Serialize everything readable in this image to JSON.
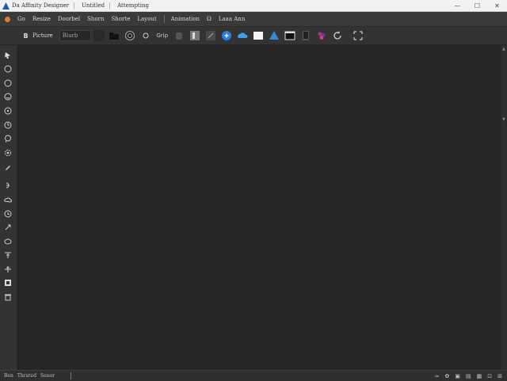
{
  "window": {
    "title_app": "Da Affinity Designer",
    "title_doc": "Untitled",
    "title_extra": "Attempting",
    "buttons": {
      "minimize": "—",
      "maximize": "☐",
      "close": "✕"
    }
  },
  "menubar": {
    "items": [
      "Go",
      "Resize",
      "Doorbel",
      "Shorn",
      "Shorte",
      "Layout",
      "Animation",
      "Ω",
      "Laaa Ann"
    ]
  },
  "toolbar": {
    "persona_label": "Picture",
    "field_value": "Blurb",
    "zoom_label": "Grip",
    "tools": [
      "folder-icon",
      "circle-icon",
      "dot-icon",
      "grip-text",
      "cup-icon",
      "square-icon",
      "dark-square-icon",
      "cube-icon",
      "cloud-icon",
      "white-square-icon",
      "triangle-icon",
      "window-icon",
      "phone-icon",
      "grapes-icon",
      "refresh-icon",
      "arrange-icon"
    ]
  },
  "left_tools": [
    "move-tool-icon",
    "ellipse-icon",
    "circle-outline-icon",
    "face-icon",
    "smile-icon",
    "node-icon",
    "lasso-icon",
    "gear-icon",
    "pen-icon",
    "blob-icon",
    "cloud-tool-icon",
    "clock-icon",
    "arrow-tool-icon",
    "oval-icon",
    "text-tool-icon",
    "cross-icon",
    "image-tool-icon",
    "trash-icon"
  ],
  "statusbar": {
    "left_items": [
      "Ben",
      "Thrated",
      "Senor"
    ],
    "right_icons": [
      "≈",
      "✿",
      "▣",
      "▤",
      "▦",
      "⊡",
      "⊞"
    ]
  }
}
